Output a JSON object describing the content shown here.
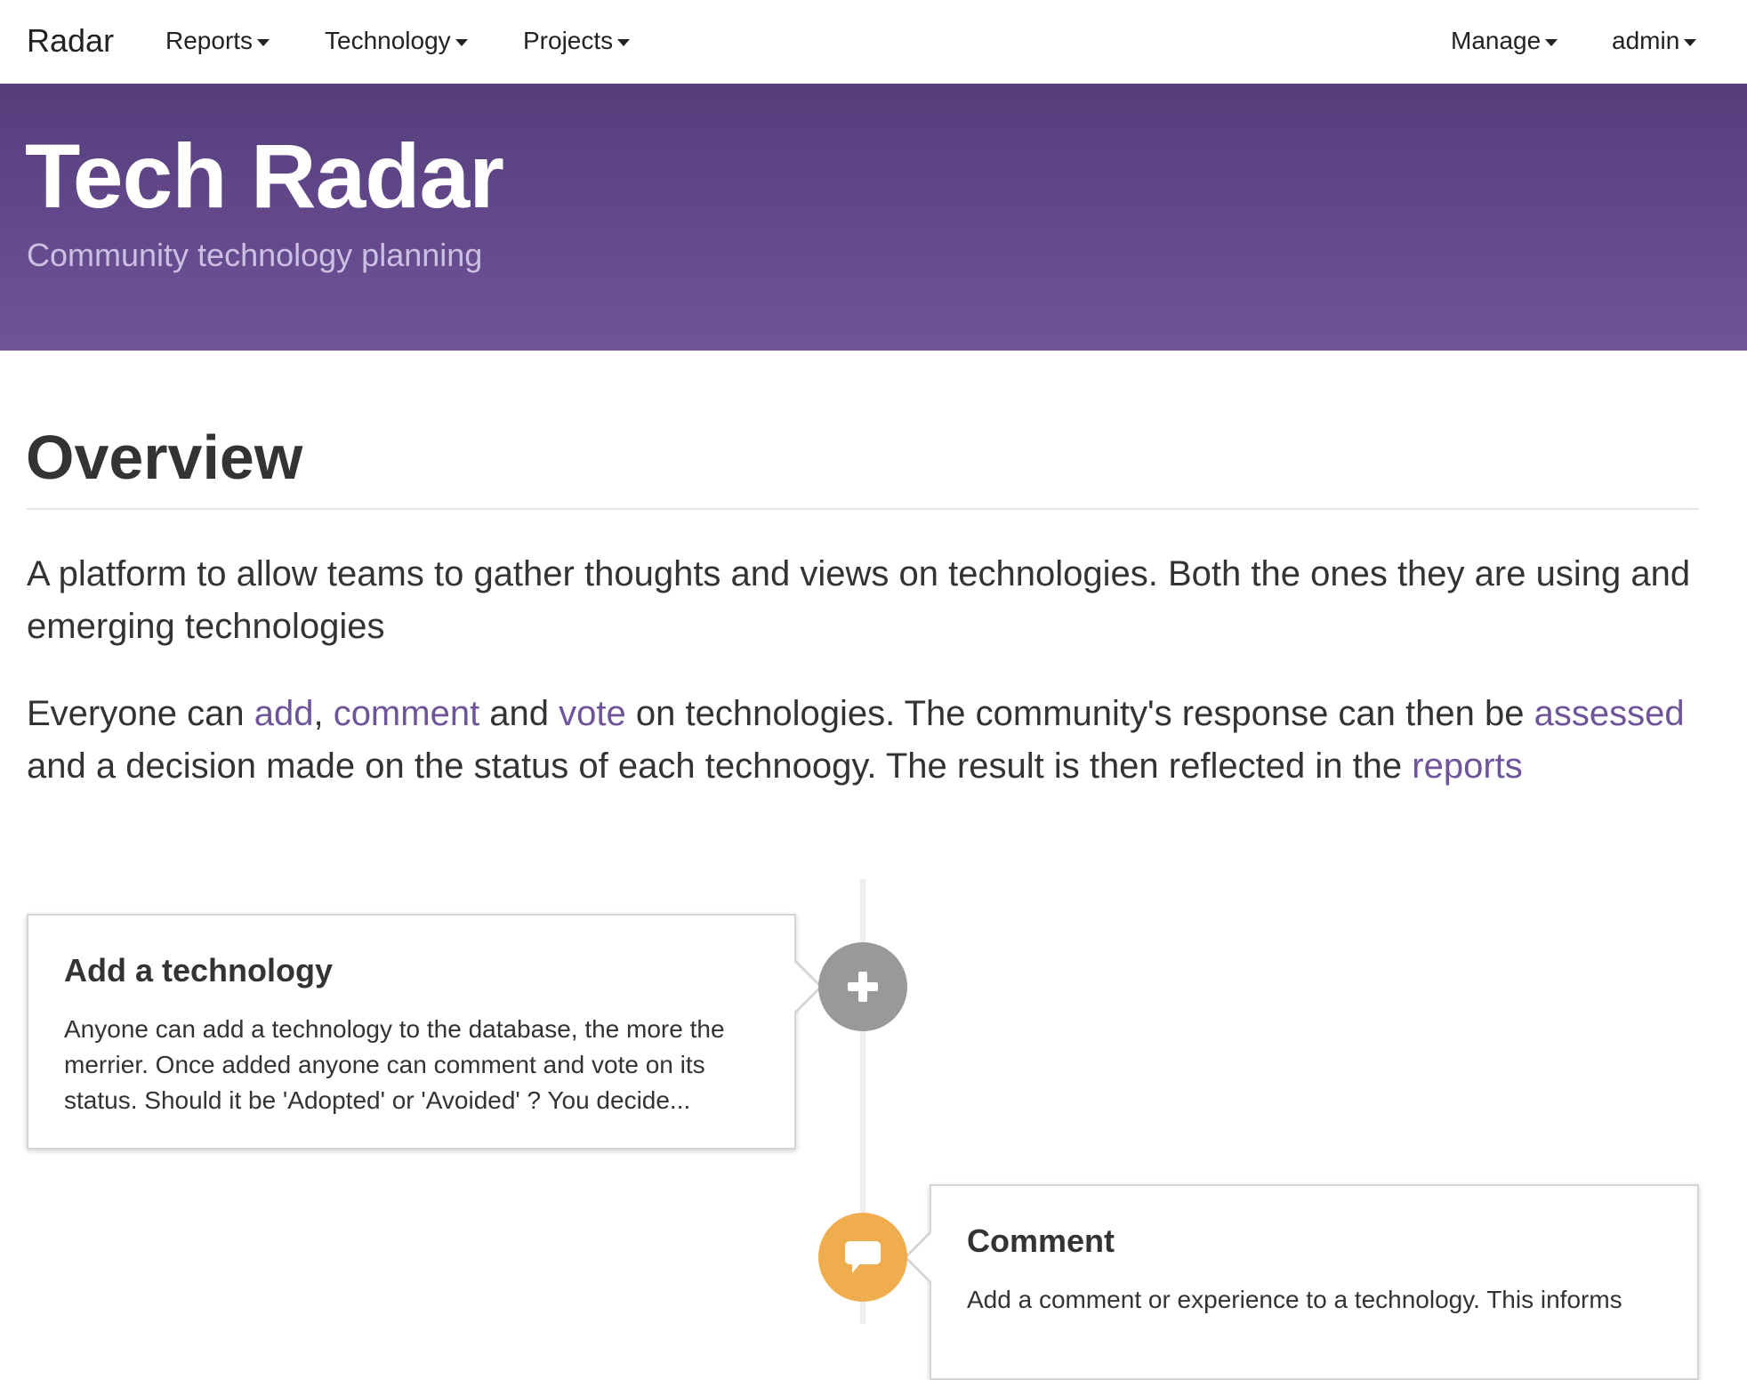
{
  "navbar": {
    "brand": "Radar",
    "left_items": [
      {
        "label": "Reports"
      },
      {
        "label": "Technology"
      },
      {
        "label": "Projects"
      }
    ],
    "right_items": [
      {
        "label": "Manage"
      },
      {
        "label": "admin"
      }
    ]
  },
  "hero": {
    "title": "Tech Radar",
    "subtitle": "Community technology planning"
  },
  "overview": {
    "heading": "Overview",
    "paragraph1": "A platform to allow teams to gather thoughts and views on technologies. Both the ones they are using and emerging technologies",
    "paragraph2": {
      "t1": "Everyone can ",
      "link_add": "add",
      "t2": ", ",
      "link_comment": "comment",
      "t3": " and ",
      "link_vote": "vote",
      "t4": " on technologies. The community's response can then be ",
      "link_assessed": "assessed",
      "t5": " and a decision made on the status of each technoogy. The result is then reflected in the ",
      "link_reports": "reports"
    }
  },
  "timeline": {
    "items": [
      {
        "title": "Add a technology",
        "body": "Anyone can add a technology to the database, the more the merrier. Once added anyone can comment and vote on its status. Should it be 'Adopted' or 'Avoided' ? You decide...",
        "icon": "plus-icon",
        "badge_color": "#999999"
      },
      {
        "title": "Comment",
        "body": "Add a comment or experience to a technology. This informs",
        "icon": "comment-icon",
        "badge_color": "#f0ad4e"
      }
    ]
  },
  "colors": {
    "hero_gradient_top": "#563d7c",
    "hero_gradient_bottom": "#6f5499",
    "link": "#6f5499"
  }
}
